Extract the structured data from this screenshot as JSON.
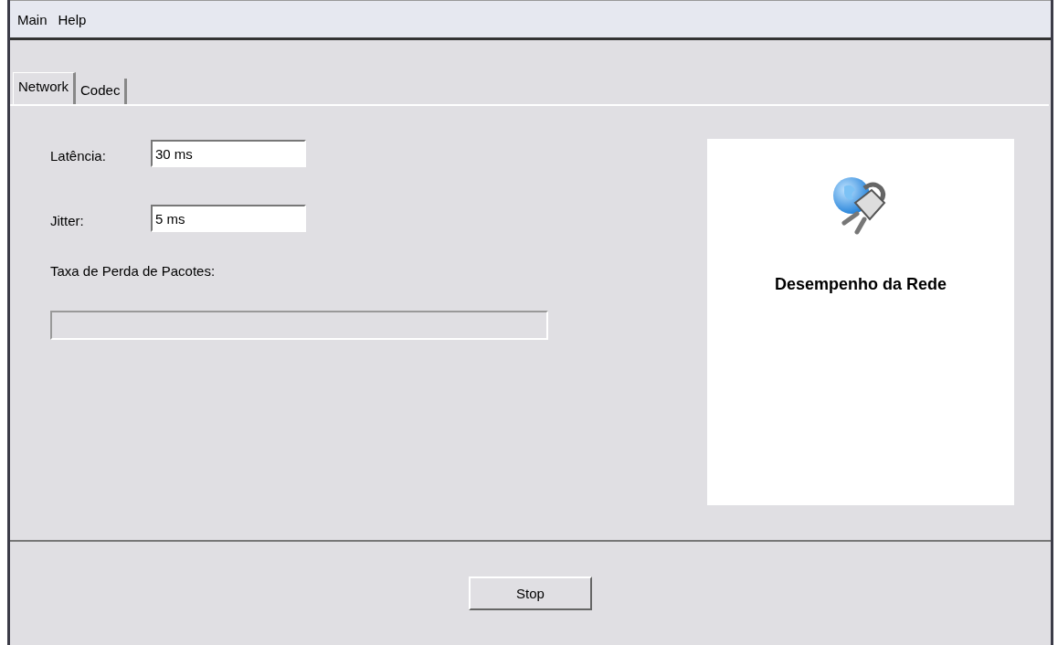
{
  "menu": [
    {
      "label": "Main"
    },
    {
      "label": "Help"
    }
  ],
  "tabs": [
    {
      "label": "Network",
      "selected": true
    },
    {
      "label": "Codec",
      "selected": false
    }
  ],
  "fields": [
    {
      "label": "Latência:",
      "value": "30 ms"
    },
    {
      "label": "Jitter:",
      "value": "5 ms"
    }
  ],
  "packet_loss": {
    "label": "Taxa de Perda de Pacotes:",
    "level": 0
  },
  "info_panel": {
    "title": "Desempenho da Rede"
  },
  "buttons": [
    {
      "label": "Stop"
    }
  ]
}
